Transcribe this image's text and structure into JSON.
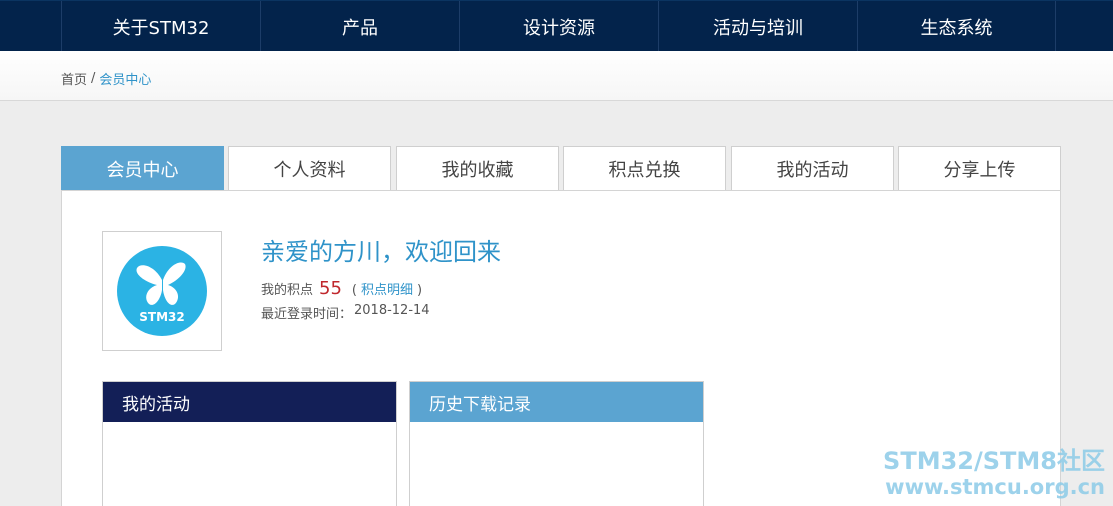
{
  "nav": {
    "items": [
      {
        "label": "关于STM32"
      },
      {
        "label": "产品"
      },
      {
        "label": "设计资源"
      },
      {
        "label": "活动与培训"
      },
      {
        "label": "生态系统"
      }
    ]
  },
  "breadcrumb": {
    "home": "首页",
    "separator": "/",
    "current": "会员中心"
  },
  "tabs": [
    {
      "label": "会员中心",
      "active": true
    },
    {
      "label": "个人资料"
    },
    {
      "label": "我的收藏"
    },
    {
      "label": "积点兑换"
    },
    {
      "label": "我的活动"
    },
    {
      "label": "分享上传"
    }
  ],
  "profile": {
    "avatar_text": "STM32",
    "welcome": "亲爱的方川，欢迎回来",
    "points_label": "我的积点",
    "points_value": "55",
    "points_link_open": "(",
    "points_link": "积点明细",
    "points_link_close": ")",
    "login_label": "最近登录时间：",
    "login_date": "2018-12-14"
  },
  "cards": {
    "activity_title": "我的活动",
    "history_title": "历史下载记录"
  },
  "watermark": {
    "line1": "STM32/STM8社区",
    "line2": "www.stmcu.org.cn"
  },
  "colors": {
    "nav_bg": "#03234b",
    "tab_active": "#5ba4d1",
    "link": "#2f93c9",
    "points": "#c0282d",
    "activity_head": "#131f57"
  }
}
